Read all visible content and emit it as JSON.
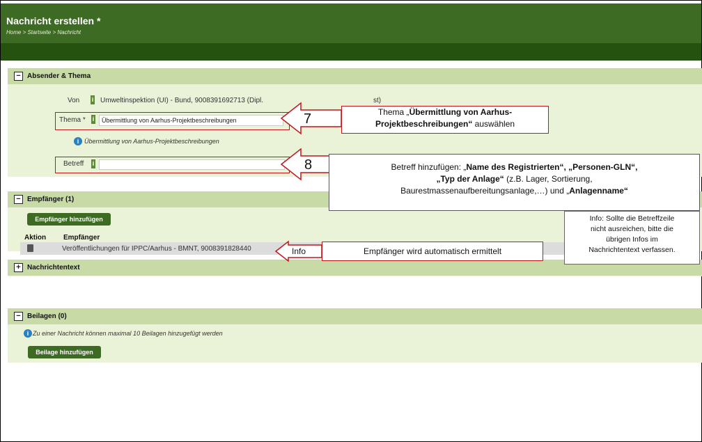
{
  "header": {
    "title": "Nachricht erstellen *",
    "breadcrumb": "Home > Startseite > Nachricht"
  },
  "section_absender": {
    "title": "Absender & Thema",
    "von_label": "Von",
    "von_value": "Umweltinspektion (UI) - Bund, 9008391692713 (Dipl.",
    "von_tail": "st)",
    "thema_label": "Thema *",
    "thema_value": "Übermittlung von Aarhus-Projektbeschreibungen",
    "thema_hint": "Übermittlung von Aarhus-Projektbeschreibungen",
    "betreff_label": "Betreff",
    "betreff_value": ""
  },
  "section_empfaenger": {
    "title": "Empfänger (1)",
    "add_button": "Empfänger hinzufügen",
    "col_aktion": "Aktion",
    "col_empfaenger": "Empfänger",
    "row_value": "Veröffentlichungen für IPPC/Aarhus - BMNT, 9008391828440"
  },
  "section_nachrichtentext": {
    "title": "Nachrichtentext"
  },
  "section_beilagen": {
    "title": "Beilagen (0)",
    "hint": "Zu einer Nachricht können maximal 10 Beilagen hinzugefügt werden",
    "add_button": "Beilage hinzufügen"
  },
  "callouts": {
    "num7": "7",
    "thema_line1_pre": "Thema „",
    "thema_line1_bold": "Übermittlung von Aarhus-",
    "thema_line2_bold": "Projektbeschreibungen“",
    "thema_line2_post": " auswählen",
    "num8": "8",
    "betreff_l1_pre": "Betreff hinzufügen: „",
    "betreff_l1_b1": "Name des Registrierten“, „Personen-GLN“,",
    "betreff_l2_b": "„Typ der Anlage“",
    "betreff_l2_post": " (z.B. Lager, Sortierung,",
    "betreff_l3_pre": "Baurestmassenaufbereitungsanlage,…) und „",
    "betreff_l3_b": "Anlagenname“",
    "info_small": [
      "Info: Sollte die Betreffzeile",
      "nicht ausreichen, bitte die",
      "übrigen Infos im",
      "Nachrichtentext verfassen."
    ],
    "info_label": "Info",
    "empfaenger_text": "Empfänger wird automatisch ermittelt"
  }
}
